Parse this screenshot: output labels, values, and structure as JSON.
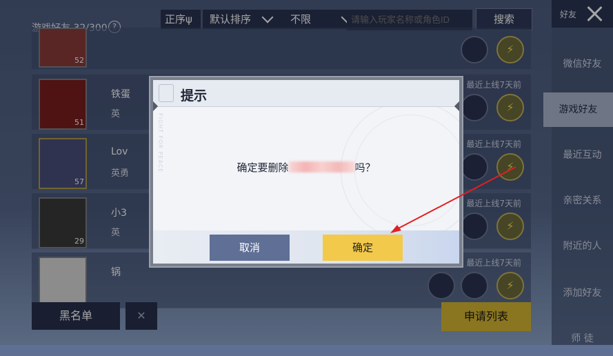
{
  "header": {
    "friend_count": "游戏好友 32/300",
    "help_icon": "?",
    "seq_label": "正序ψ",
    "sort_label": "默认排序",
    "range_label": "不限",
    "search_placeholder": "请输入玩家名称或角色ID",
    "search_button": "搜索"
  },
  "friends": [
    {
      "level": "52",
      "name": "",
      "sub": "",
      "last_online": ""
    },
    {
      "level": "51",
      "name": "铁蛋",
      "sub": "英",
      "last_online": "最近上线7天前"
    },
    {
      "level": "57",
      "name": "Lov",
      "sub": "英勇",
      "last_online": "最近上线7天前"
    },
    {
      "level": "29",
      "name": "小3",
      "sub": "英",
      "last_online": "最近上线7天前"
    },
    {
      "level": "",
      "name": "锅",
      "sub": "",
      "last_online": "最近上线7天前"
    }
  ],
  "bottom": {
    "blacklist": "黑名单",
    "apply_list": "申请列表"
  },
  "sidebar": {
    "header": "好友",
    "items": [
      "微信好友",
      "游戏好友",
      "最近互动",
      "亲密关系",
      "附近的人",
      "添加好友",
      "师 徒"
    ]
  },
  "modal": {
    "title": "提示",
    "message_prefix": "确定要删除",
    "message_suffix": "吗？",
    "watermark": "FIGHT FOR PEACE",
    "cancel": "取消",
    "confirm": "确定"
  },
  "colors": {
    "accent_yellow": "#f2c94a",
    "cancel_blue": "#5f6f96",
    "arrow_red": "#e02020"
  },
  "icons": {
    "close": "close-icon",
    "chat": "chat-icon",
    "gift": "lightning-icon"
  }
}
